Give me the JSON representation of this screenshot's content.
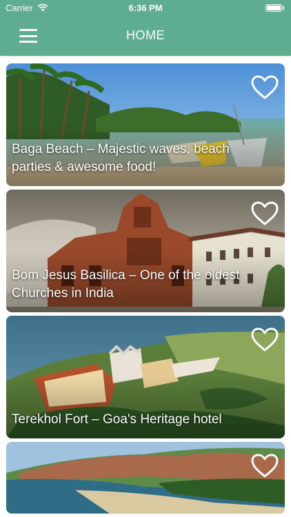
{
  "status_bar": {
    "carrier": "Carrier",
    "time": "6:36 PM"
  },
  "nav": {
    "title": "HOME",
    "menu_icon": "hamburger-menu-icon"
  },
  "theme": {
    "primary": "#5fae91",
    "text_on_primary": "#ffffff"
  },
  "places": [
    {
      "title": "Baga Beach – Majestic waves, beach parties & awesome food!",
      "favorite_icon": "heart-outline-icon"
    },
    {
      "title": "Bom Jesus Basilica – One of the oldest Churches in India",
      "favorite_icon": "heart-outline-icon"
    },
    {
      "title": "Terekhol Fort – Goa's Heritage hotel",
      "favorite_icon": "heart-outline-icon"
    },
    {
      "title": "",
      "favorite_icon": "heart-outline-icon"
    }
  ]
}
